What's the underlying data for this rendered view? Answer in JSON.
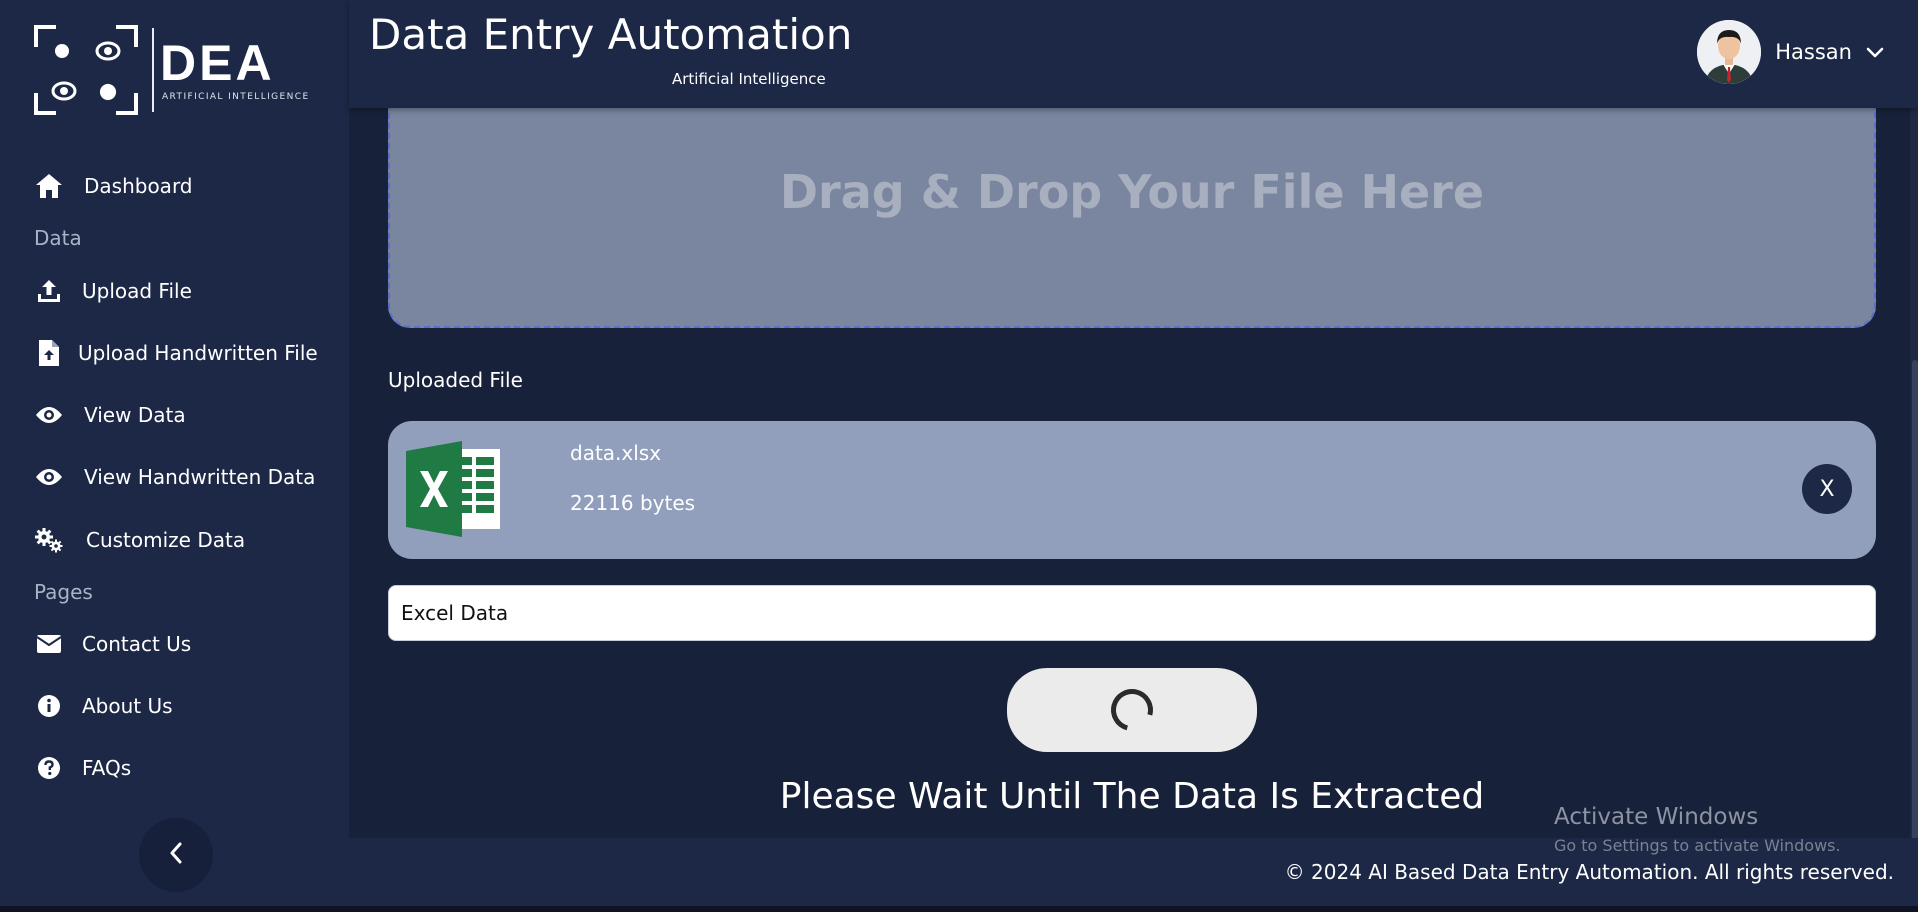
{
  "brand": {
    "logo_title": "DEA",
    "logo_subtitle": "ARTIFICIAL INTELLIGENCE"
  },
  "header": {
    "title": "Data Entry Automation",
    "subtitle": "Artificial Intelligence",
    "user_name": "Hassan"
  },
  "sidebar": {
    "dashboard": "Dashboard",
    "section_data": "Data",
    "upload_file": "Upload File",
    "upload_handwritten": "Upload Handwritten File",
    "view_data": "View Data",
    "view_handwritten": "View Handwritten Data",
    "customize_data": "Customize Data",
    "section_pages": "Pages",
    "contact_us": "Contact Us",
    "about_us": "About Us",
    "faqs": "FAQs"
  },
  "main": {
    "dropzone_text": "Drag & Drop Your File Here",
    "uploaded_label": "Uploaded File",
    "file": {
      "name": "data.xlsx",
      "size": "22116 bytes",
      "remove_label": "X"
    },
    "name_input_value": "Excel Data",
    "status_text": "Please Wait Until The Data Is Extracted"
  },
  "footer": {
    "copyright": "© 2024 AI Based Data Entry Automation. All rights reserved."
  },
  "watermark": {
    "title": "Activate Windows",
    "subtitle": "Go to Settings to activate Windows."
  },
  "colors": {
    "sidebar_bg": "#1c2846",
    "main_bg": "#18213a",
    "dropzone_bg": "#7a859f",
    "file_card_bg": "#919fbd",
    "excel_green": "#1f7a43"
  }
}
